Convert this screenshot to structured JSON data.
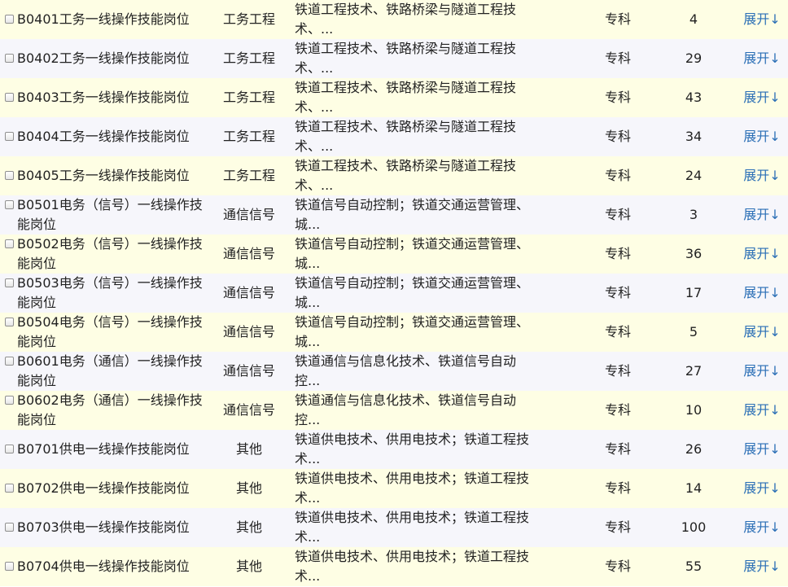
{
  "colors": {
    "row_odd": "#fefee4",
    "row_even": "#f6f6fb",
    "link": "#2b6fb6"
  },
  "rows": [
    {
      "name": "B0401工务一线操作技能岗位",
      "category": "工务工程",
      "majors": "铁道工程技术、铁路桥梁与隧道工程技术、...",
      "education": "专科",
      "count": "4",
      "action": "展开↓"
    },
    {
      "name": "B0402工务一线操作技能岗位",
      "category": "工务工程",
      "majors": "铁道工程技术、铁路桥梁与隧道工程技术、...",
      "education": "专科",
      "count": "29",
      "action": "展开↓"
    },
    {
      "name": "B0403工务一线操作技能岗位",
      "category": "工务工程",
      "majors": "铁道工程技术、铁路桥梁与隧道工程技术、...",
      "education": "专科",
      "count": "43",
      "action": "展开↓"
    },
    {
      "name": "B0404工务一线操作技能岗位",
      "category": "工务工程",
      "majors": "铁道工程技术、铁路桥梁与隧道工程技术、...",
      "education": "专科",
      "count": "34",
      "action": "展开↓"
    },
    {
      "name": "B0405工务一线操作技能岗位",
      "category": "工务工程",
      "majors": "铁道工程技术、铁路桥梁与隧道工程技术、...",
      "education": "专科",
      "count": "24",
      "action": "展开↓"
    },
    {
      "name": "B0501电务（信号）一线操作技能岗位",
      "category": "通信信号",
      "majors": "铁道信号自动控制；铁道交通运营管理、城...",
      "education": "专科",
      "count": "3",
      "action": "展开↓"
    },
    {
      "name": "B0502电务（信号）一线操作技能岗位",
      "category": "通信信号",
      "majors": "铁道信号自动控制；铁道交通运营管理、城...",
      "education": "专科",
      "count": "36",
      "action": "展开↓"
    },
    {
      "name": "B0503电务（信号）一线操作技能岗位",
      "category": "通信信号",
      "majors": "铁道信号自动控制；铁道交通运营管理、城...",
      "education": "专科",
      "count": "17",
      "action": "展开↓"
    },
    {
      "name": "B0504电务（信号）一线操作技能岗位",
      "category": "通信信号",
      "majors": "铁道信号自动控制；铁道交通运营管理、城...",
      "education": "专科",
      "count": "5",
      "action": "展开↓"
    },
    {
      "name": "B0601电务（通信）一线操作技能岗位",
      "category": "通信信号",
      "majors": "铁道通信与信息化技术、铁道信号自动控...",
      "education": "专科",
      "count": "27",
      "action": "展开↓"
    },
    {
      "name": "B0602电务（通信）一线操作技能岗位",
      "category": "通信信号",
      "majors": "铁道通信与信息化技术、铁道信号自动控...",
      "education": "专科",
      "count": "10",
      "action": "展开↓"
    },
    {
      "name": "B0701供电一线操作技能岗位",
      "category": "其他",
      "majors": "铁道供电技术、供用电技术；铁道工程技术...",
      "education": "专科",
      "count": "26",
      "action": "展开↓"
    },
    {
      "name": "B0702供电一线操作技能岗位",
      "category": "其他",
      "majors": "铁道供电技术、供用电技术；铁道工程技术...",
      "education": "专科",
      "count": "14",
      "action": "展开↓"
    },
    {
      "name": "B0703供电一线操作技能岗位",
      "category": "其他",
      "majors": "铁道供电技术、供用电技术；铁道工程技术...",
      "education": "专科",
      "count": "100",
      "action": "展开↓"
    },
    {
      "name": "B0704供电一线操作技能岗位",
      "category": "其他",
      "majors": "铁道供电技术、供用电技术；铁道工程技术...",
      "education": "专科",
      "count": "55",
      "action": "展开↓"
    }
  ]
}
